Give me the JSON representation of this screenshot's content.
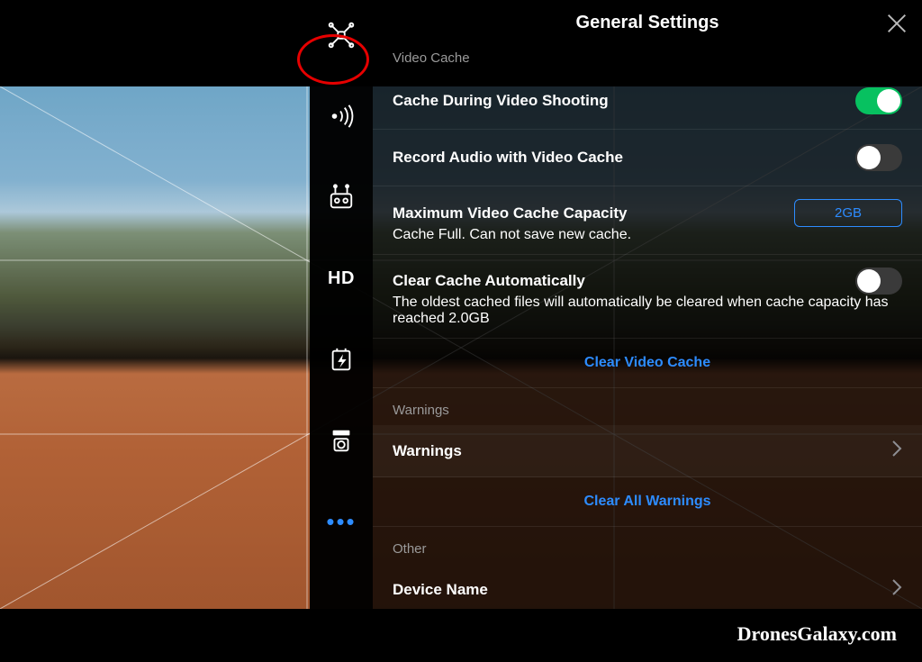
{
  "header": {
    "title": "General Settings"
  },
  "sections": {
    "video_cache_label": "Video Cache",
    "cache_during_shooting": "Cache During Video Shooting",
    "record_audio": "Record Audio with Video Cache",
    "max_capacity_label": "Maximum Video Cache Capacity",
    "max_capacity_value": "2GB",
    "cache_full_msg": "Cache Full. Can not save new cache.",
    "clear_auto_label": "Clear Cache Automatically",
    "clear_auto_desc": "The oldest cached files will automatically be cleared when cache capacity has reached 2.0GB",
    "clear_video_cache": "Clear Video Cache",
    "warnings_header": "Warnings",
    "warnings_row": "Warnings",
    "clear_all_warnings": "Clear All Warnings",
    "other_header": "Other",
    "device_name": "Device Name"
  },
  "rail_hd": "HD",
  "watermark": "DronesGalaxy.com"
}
